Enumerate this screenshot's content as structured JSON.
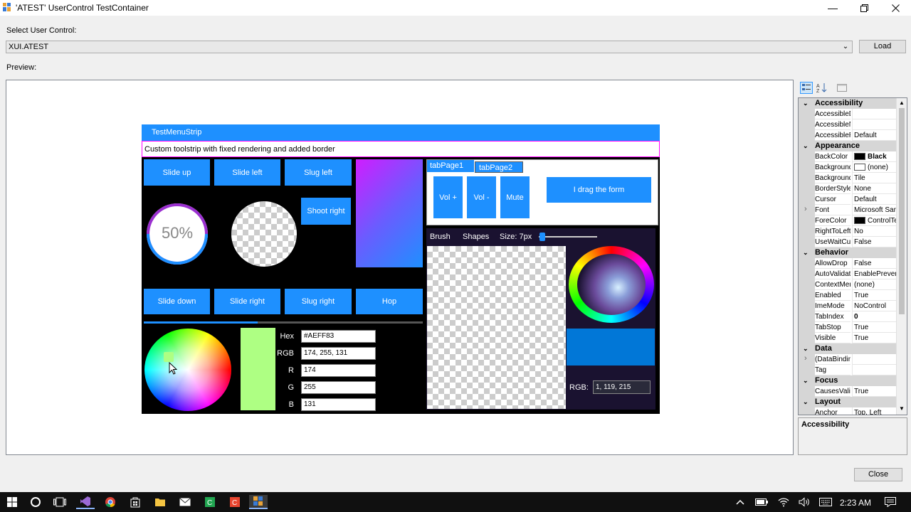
{
  "window": {
    "title": "'ATEST' UserControl TestContainer"
  },
  "form": {
    "select_label": "Select User Control:",
    "select_value": "XUI.ATEST",
    "load_label": "Load",
    "preview_label": "Preview:",
    "close_label": "Close"
  },
  "control": {
    "menustrip_label": "TestMenuStrip",
    "toolstrip_text": "Custom toolstrip with fixed rendering and added border",
    "buttons_top": [
      "Slide up",
      "Slide left",
      "Slug left"
    ],
    "shoot_right": "Shoot right",
    "progress_value": "50%",
    "progress_fraction": 0.5,
    "buttons_bottom": [
      "Slide down",
      "Slide right",
      "Slug right",
      "Hop"
    ],
    "tabs": [
      "tabPage1",
      "tabPage2"
    ],
    "tab_buttons": [
      "Vol +",
      "Vol -",
      "Mute"
    ],
    "drag_button": "I drag the form",
    "paint_menu": {
      "brush": "Brush",
      "shapes": "Shapes",
      "size": "Size: 7px"
    },
    "color_picker": {
      "selected_color": "#AEFF83",
      "hex_label": "Hex",
      "hex_value": "#AEFF83",
      "rgb_label": "RGB",
      "rgb_value": "174, 255, 131",
      "r_label": "R",
      "r_value": "174",
      "g_label": "G",
      "g_value": "255",
      "b_label": "B",
      "b_value": "131"
    },
    "wheel2": {
      "rgb_label": "RGB:",
      "rgb_value": "1, 119, 215",
      "selected_color": "#0177d7"
    }
  },
  "property_grid": {
    "description_title": "Accessibility",
    "rows": [
      {
        "type": "cat",
        "name": "Accessibility"
      },
      {
        "type": "prop",
        "name": "AccessibleDescription",
        "value": ""
      },
      {
        "type": "prop",
        "name": "AccessibleName",
        "value": ""
      },
      {
        "type": "prop",
        "name": "AccessibleRole",
        "value": "Default"
      },
      {
        "type": "cat",
        "name": "Appearance"
      },
      {
        "type": "prop",
        "name": "BackColor",
        "value": "Black",
        "swatch": "#000000",
        "bold": true
      },
      {
        "type": "prop",
        "name": "BackgroundImage",
        "value": "(none)",
        "swatch": "#ffffff"
      },
      {
        "type": "prop",
        "name": "BackgroundImageLayout",
        "value": "Tile"
      },
      {
        "type": "prop",
        "name": "BorderStyle",
        "value": "None"
      },
      {
        "type": "prop",
        "name": "Cursor",
        "value": "Default"
      },
      {
        "type": "prop",
        "name": "Font",
        "value": "Microsoft Sans Serif",
        "expand": true
      },
      {
        "type": "prop",
        "name": "ForeColor",
        "value": "ControlText",
        "swatch": "#000000"
      },
      {
        "type": "prop",
        "name": "RightToLeft",
        "value": "No"
      },
      {
        "type": "prop",
        "name": "UseWaitCursor",
        "value": "False"
      },
      {
        "type": "cat",
        "name": "Behavior"
      },
      {
        "type": "prop",
        "name": "AllowDrop",
        "value": "False"
      },
      {
        "type": "prop",
        "name": "AutoValidate",
        "value": "EnablePreventFocusChange"
      },
      {
        "type": "prop",
        "name": "ContextMenuStrip",
        "value": "(none)"
      },
      {
        "type": "prop",
        "name": "Enabled",
        "value": "True"
      },
      {
        "type": "prop",
        "name": "ImeMode",
        "value": "NoControl"
      },
      {
        "type": "prop",
        "name": "TabIndex",
        "value": "0",
        "bold": true
      },
      {
        "type": "prop",
        "name": "TabStop",
        "value": "True"
      },
      {
        "type": "prop",
        "name": "Visible",
        "value": "True"
      },
      {
        "type": "cat",
        "name": "Data"
      },
      {
        "type": "prop",
        "name": "(DataBindings)",
        "value": "",
        "expand": true
      },
      {
        "type": "prop",
        "name": "Tag",
        "value": ""
      },
      {
        "type": "cat",
        "name": "Focus"
      },
      {
        "type": "prop",
        "name": "CausesValidation",
        "value": "True"
      },
      {
        "type": "cat",
        "name": "Layout"
      },
      {
        "type": "prop",
        "name": "Anchor",
        "value": "Top, Left"
      }
    ]
  },
  "taskbar": {
    "time": "2:23 AM"
  },
  "colors": {
    "accent_blue": "#1e90ff",
    "control_bg": "#000000",
    "paint_bg": "#1a1230"
  }
}
